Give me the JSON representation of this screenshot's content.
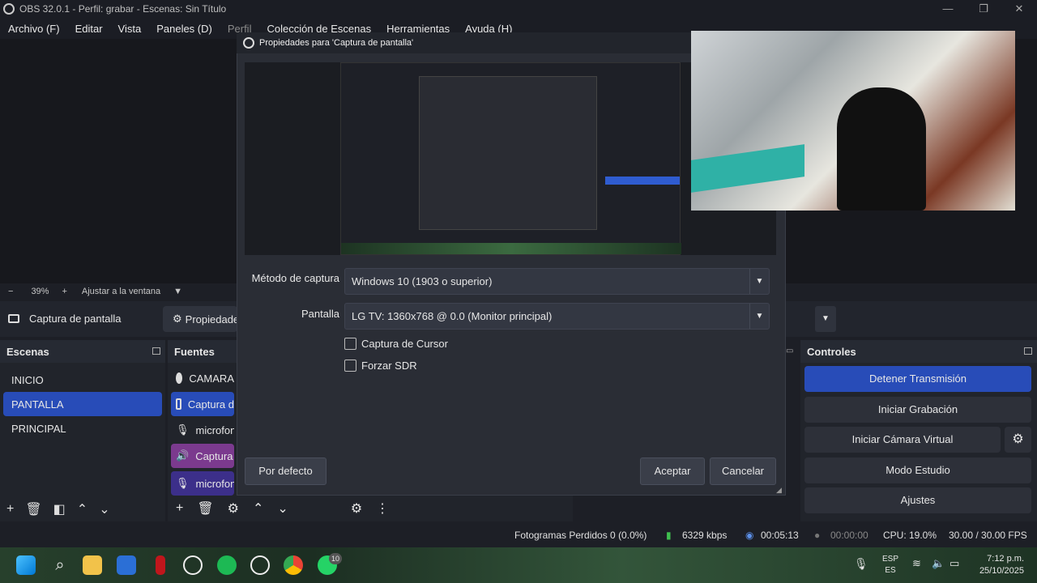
{
  "window": {
    "title": "OBS 32.0.1 - Perfil: grabar - Escenas: Sin Título",
    "min_icon": "minimize-icon",
    "max_icon": "restore-icon",
    "close_icon": "close-icon"
  },
  "menu": [
    "Archivo (F)",
    "Editar",
    "Vista",
    "Paneles (D)",
    "Perfil",
    "Colección de Escenas",
    "Herramientas",
    "Ayuda (H)"
  ],
  "zoom": {
    "minus": "−",
    "value": "39%",
    "plus": "+",
    "fit": "Ajustar a la ventana"
  },
  "source_bar": {
    "name": "Captura de pantalla",
    "properties": "Propiedades"
  },
  "scenes": {
    "title": "Escenas",
    "items": [
      "INICIO",
      "PANTALLA",
      "PRINCIPAL"
    ],
    "selected": 1
  },
  "sources": {
    "title": "Fuentes",
    "items": [
      "CAMARA",
      "Captura d",
      "microfono",
      "Captura d",
      "microfono"
    ]
  },
  "controls": {
    "title": "Controles",
    "buttons": [
      "Detener Transmisión",
      "Iniciar Grabación",
      "Iniciar Cámara Virtual",
      "Modo Estudio",
      "Ajustes"
    ]
  },
  "dialog": {
    "title": "Propiedades para 'Captura de pantalla'",
    "capture_method_label": "Método de captura",
    "capture_method_value": "Windows 10 (1903 o superior)",
    "display_label": "Pantalla",
    "display_value": "LG TV: 1360x768 @ 0.0 (Monitor principal)",
    "cursor_checkbox": "Captura de Cursor",
    "sdr_checkbox": "Forzar SDR",
    "defaults_button": "Por defecto",
    "ok_button": "Aceptar",
    "cancel_button": "Cancelar"
  },
  "status": {
    "dropped": "Fotogramas Perdidos 0 (0.0%)",
    "bitrate": "6329 kbps",
    "stream_time": "00:05:13",
    "rec_time": "00:00:00",
    "cpu": "CPU: 19.0%",
    "fps": "30.00 / 30.00 FPS"
  },
  "taskbar": {
    "lang": "ESP",
    "lang_sub": "ES",
    "time": "7:12 p.m.",
    "date": "25/10/2025",
    "badge": "10"
  },
  "colors": {
    "accent": "#284cb8",
    "background": "#1d1f26"
  }
}
